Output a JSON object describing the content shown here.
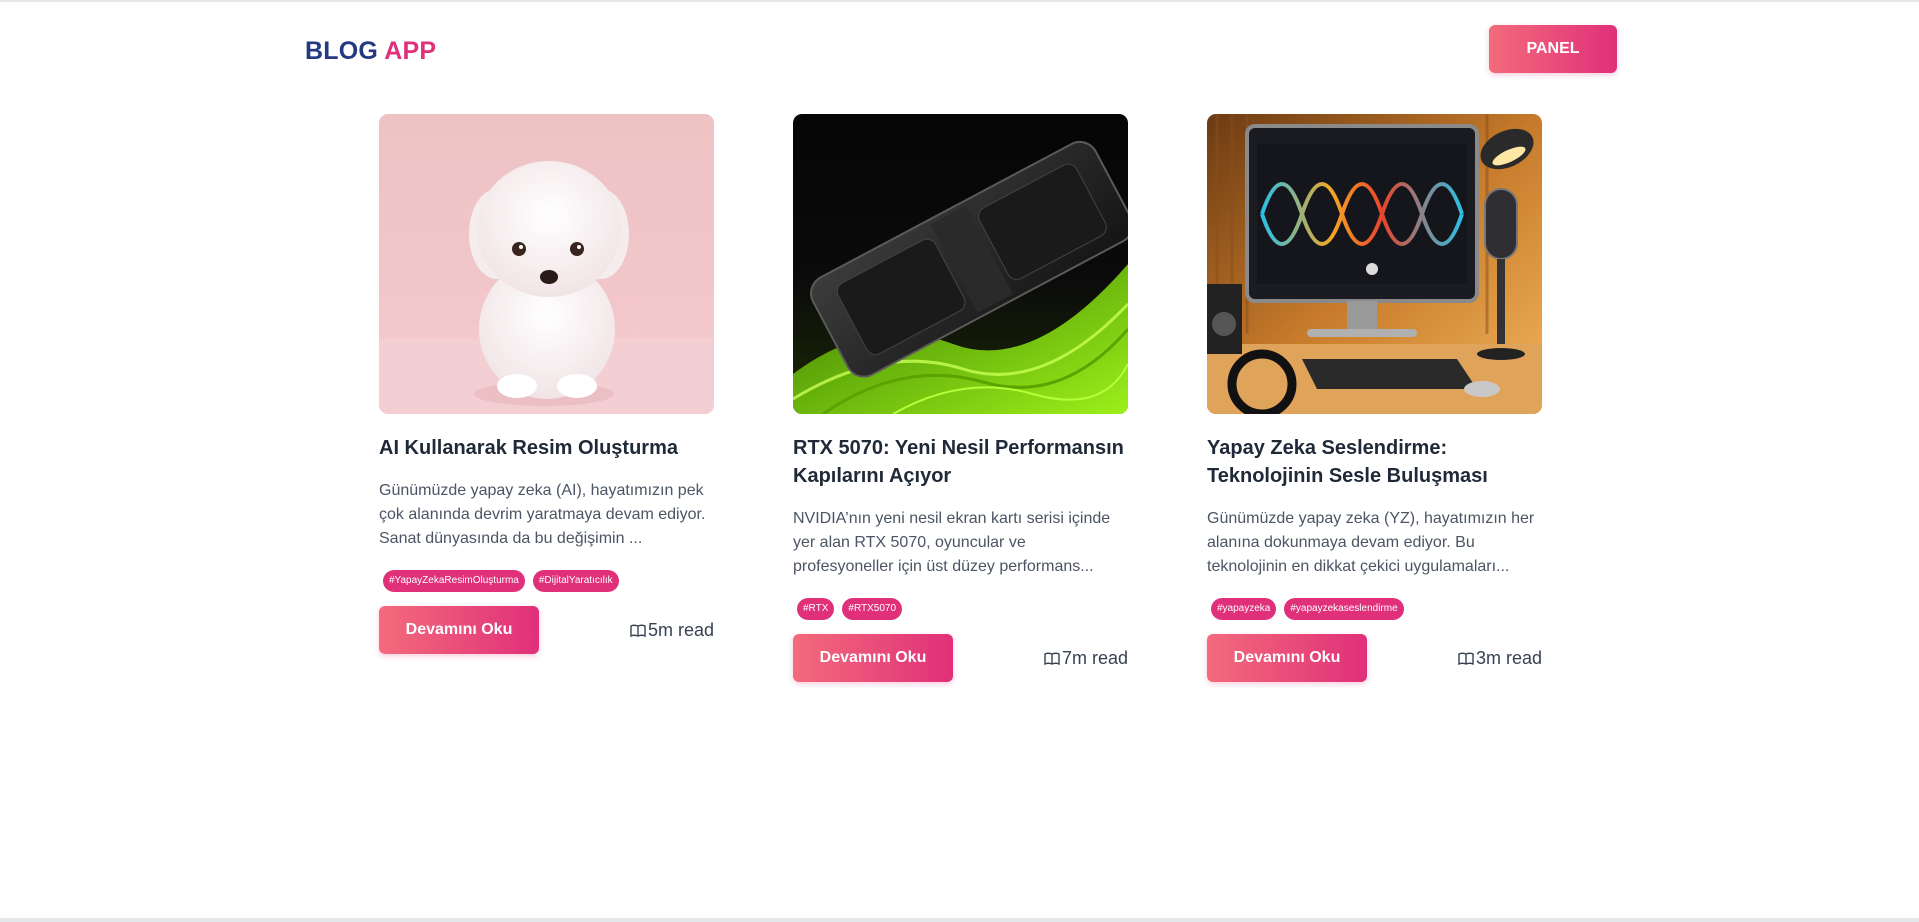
{
  "header": {
    "brand_part1": "BLOG",
    "brand_part2": "APP",
    "panel_label": "PANEL"
  },
  "colors": {
    "brand_navy": "#243a80",
    "brand_pink": "#e0307a",
    "gradient_start": "#f36b7b",
    "gradient_end": "#e0307a"
  },
  "posts": [
    {
      "image": "white-puppy-illustration",
      "title": "AI Kullanarak Resim Oluşturma",
      "description": "Günümüzde yapay zeka (AI), hayatımızın pek çok alanında devrim yaratmaya devam ediyor. Sanat dünyasında da bu değişimin ...",
      "tags": [
        "#YapayZekaResimOluşturma",
        "#DijitalYaratıcılık"
      ],
      "button": "Devamını Oku",
      "read_time": "5m read"
    },
    {
      "image": "graphics-card-illustration",
      "title": "RTX 5070: Yeni Nesil Performansın Kapılarını Açıyor",
      "description": "NVIDIA’nın yeni nesil ekran kartı serisi içinde yer alan RTX 5070, oyuncular ve profesyoneller için üst düzey performans...",
      "tags": [
        "#RTX",
        "#RTX5070"
      ],
      "button": "Devamını Oku",
      "read_time": "7m read"
    },
    {
      "image": "podcast-studio-illustration",
      "title": "Yapay Zeka Seslendirme: Teknolojinin Sesle Buluşması",
      "description": "Günümüzde yapay zeka (YZ), hayatımızın her alanına dokunmaya devam ediyor. Bu teknolojinin en dikkat çekici uygulamaları...",
      "tags": [
        "#yapayzeka",
        "#yapayzekaseslendirme"
      ],
      "button": "Devamını Oku",
      "read_time": "3m read"
    }
  ]
}
